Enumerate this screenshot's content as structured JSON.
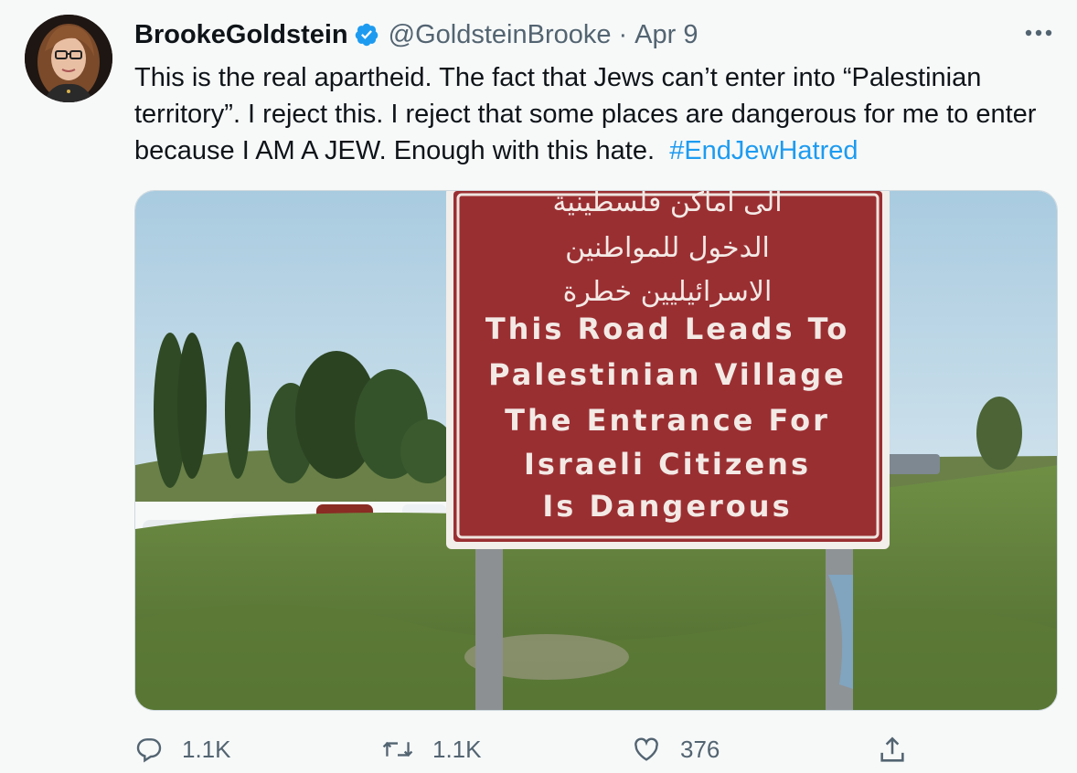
{
  "tweet": {
    "display_name": "BrookeGoldstein",
    "handle": "@GoldsteinBrooke",
    "separator": "·",
    "date": "Apr 9",
    "text_before_hashtag": "This is the real apartheid. The fact that Jews can’t enter into “Palestinian territory”. I reject this. I reject that some places are dangerous for me to enter because I AM A JEW. Enough with this hate.",
    "hashtag": "#EndJewHatred",
    "verified": true
  },
  "media": {
    "sign_arabic": [
      "الى اماكن فلسطينية",
      "الدخول للمواطنين",
      "الاسرائيليين خطرة"
    ],
    "sign_english": [
      "This Road Leads To",
      "Palestinian Village",
      "The Entrance For",
      "Israeli Citizens",
      "Is Dangerous"
    ]
  },
  "actions": {
    "reply_count": "1.1K",
    "retweet_count": "1.1K",
    "like_count": "376"
  },
  "icons": {
    "reply": "reply-icon",
    "retweet": "retweet-icon",
    "like": "heart-icon",
    "share": "share-icon",
    "more": "more-icon",
    "verified": "verified-badge-icon"
  },
  "colors": {
    "accent": "#1d9bf0",
    "secondary_text": "#536471",
    "sign_red": "#9a2f32"
  }
}
